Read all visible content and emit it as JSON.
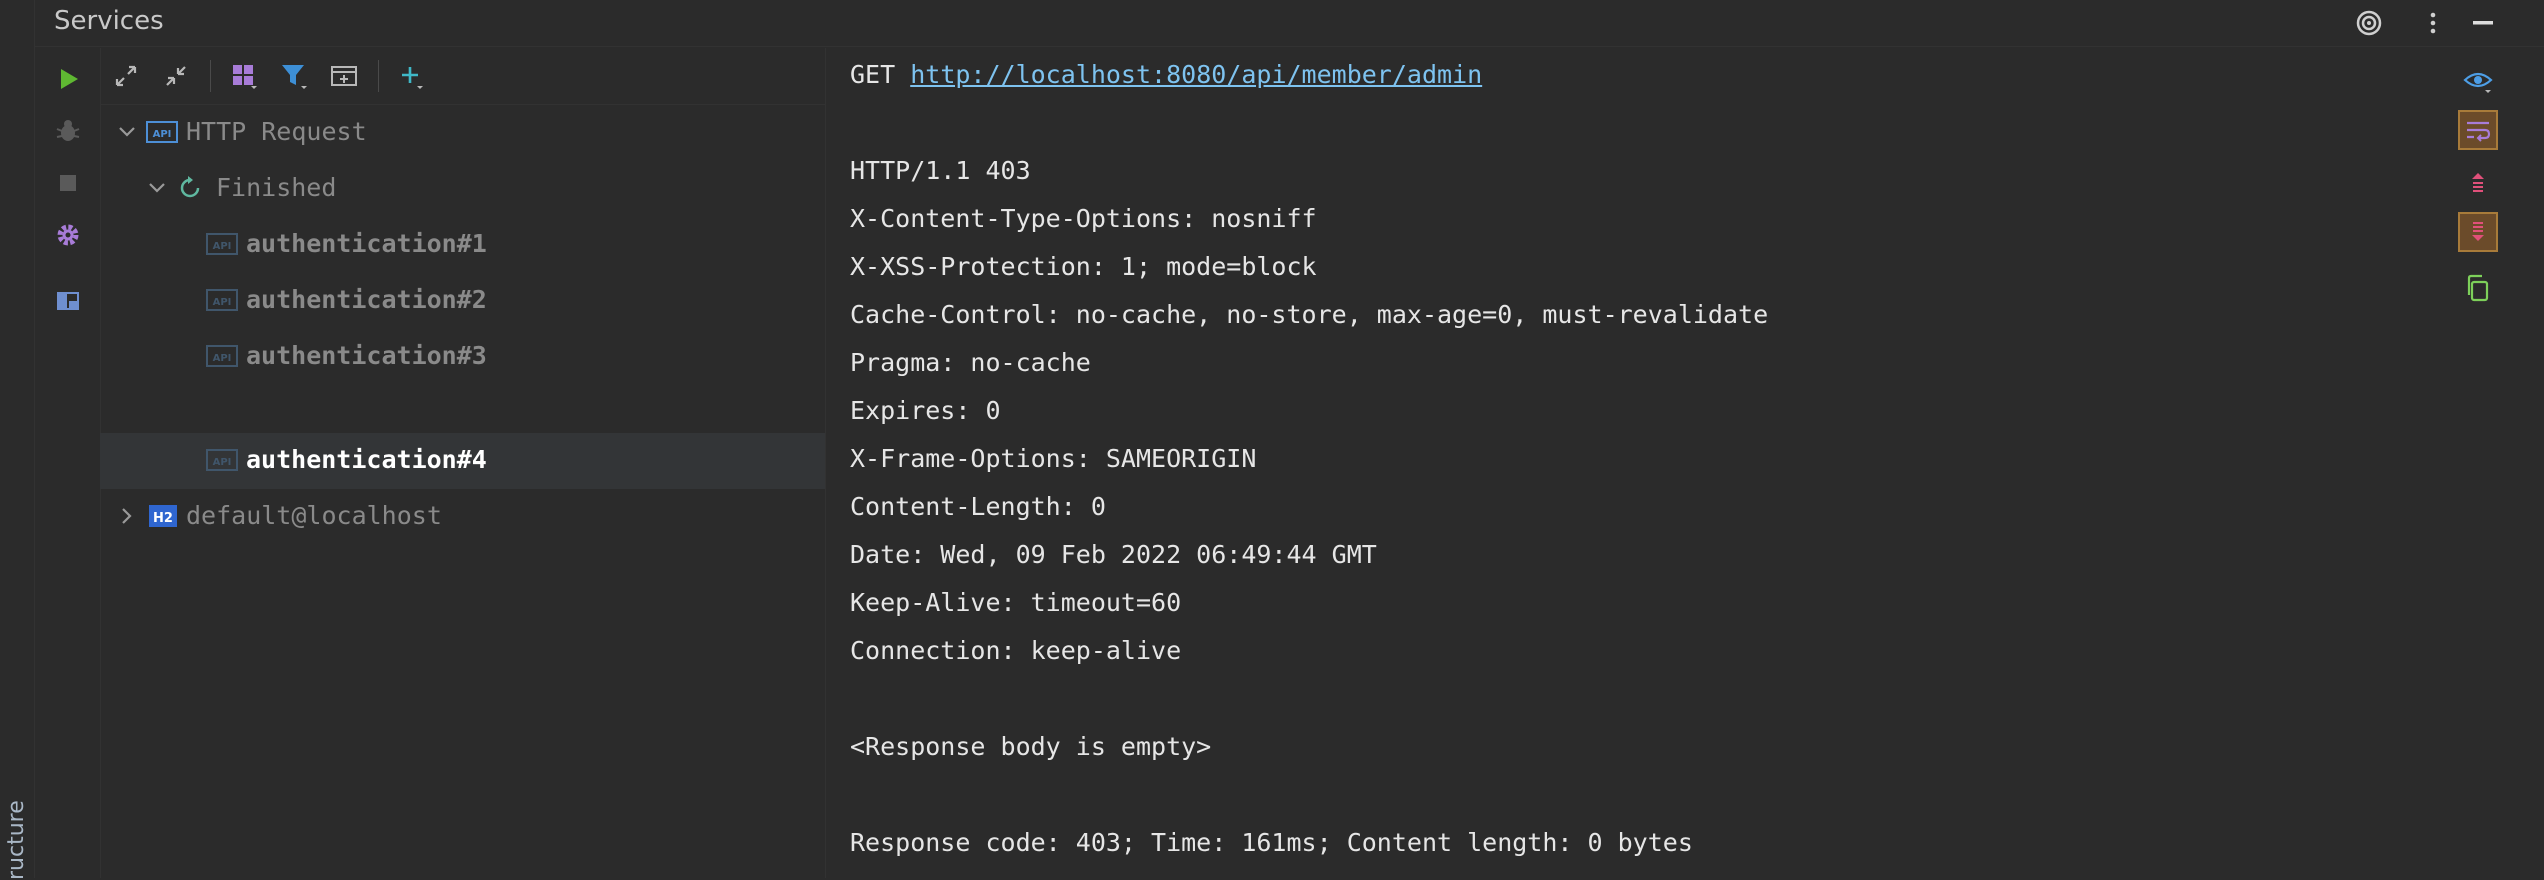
{
  "window": {
    "title": "Services"
  },
  "left_stripe": {
    "label": "ructure"
  },
  "header_icons": [
    "target-icon",
    "more-vertical-icon",
    "minimize-icon"
  ],
  "side_toolbar": [
    "run-icon",
    "debug-icon",
    "stop-icon",
    "settings-icon",
    "layout-icon"
  ],
  "tree_toolbar": [
    "expand-all-icon",
    "collapse-all-icon",
    "group-by-icon",
    "filter-icon",
    "new-tab-icon",
    "add-service-icon"
  ],
  "tree": {
    "root": {
      "label": "HTTP Request",
      "icon_text": "API"
    },
    "group": {
      "label": "Finished"
    },
    "items": [
      {
        "label": "authentication#1",
        "icon_text": "API"
      },
      {
        "label": "authentication#2",
        "icon_text": "API"
      },
      {
        "label": "authentication#3",
        "icon_text": "API"
      },
      {
        "label": "authentication#4",
        "icon_text": "API"
      }
    ],
    "db": {
      "label": "default@localhost",
      "icon_text": "H2"
    }
  },
  "response": {
    "method": "GET",
    "url": "http://localhost:8080/api/member/admin",
    "lines": [
      "HTTP/1.1 403",
      "X-Content-Type-Options: nosniff",
      "X-XSS-Protection: 1; mode=block",
      "Cache-Control: no-cache, no-store, max-age=0, must-revalidate",
      "Pragma: no-cache",
      "Expires: 0",
      "X-Frame-Options: SAMEORIGIN",
      "Content-Length: 0",
      "Date: Wed, 09 Feb 2022 06:49:44 GMT",
      "Keep-Alive: timeout=60",
      "Connection: keep-alive"
    ],
    "body": "<Response body is empty>",
    "summary": "Response code: 403; Time: 161ms; Content length: 0 bytes"
  },
  "right_bar": [
    "eye-icon",
    "soft-wrap-icon",
    "scroll-up-icon",
    "scroll-to-end-icon",
    "copy-icon"
  ],
  "colors": {
    "background": "#2b2b2b",
    "link": "#7ec3f0",
    "run": "#5fb832",
    "accent_purple": "#a87cd8",
    "active_btn": "#6b4b2a"
  }
}
